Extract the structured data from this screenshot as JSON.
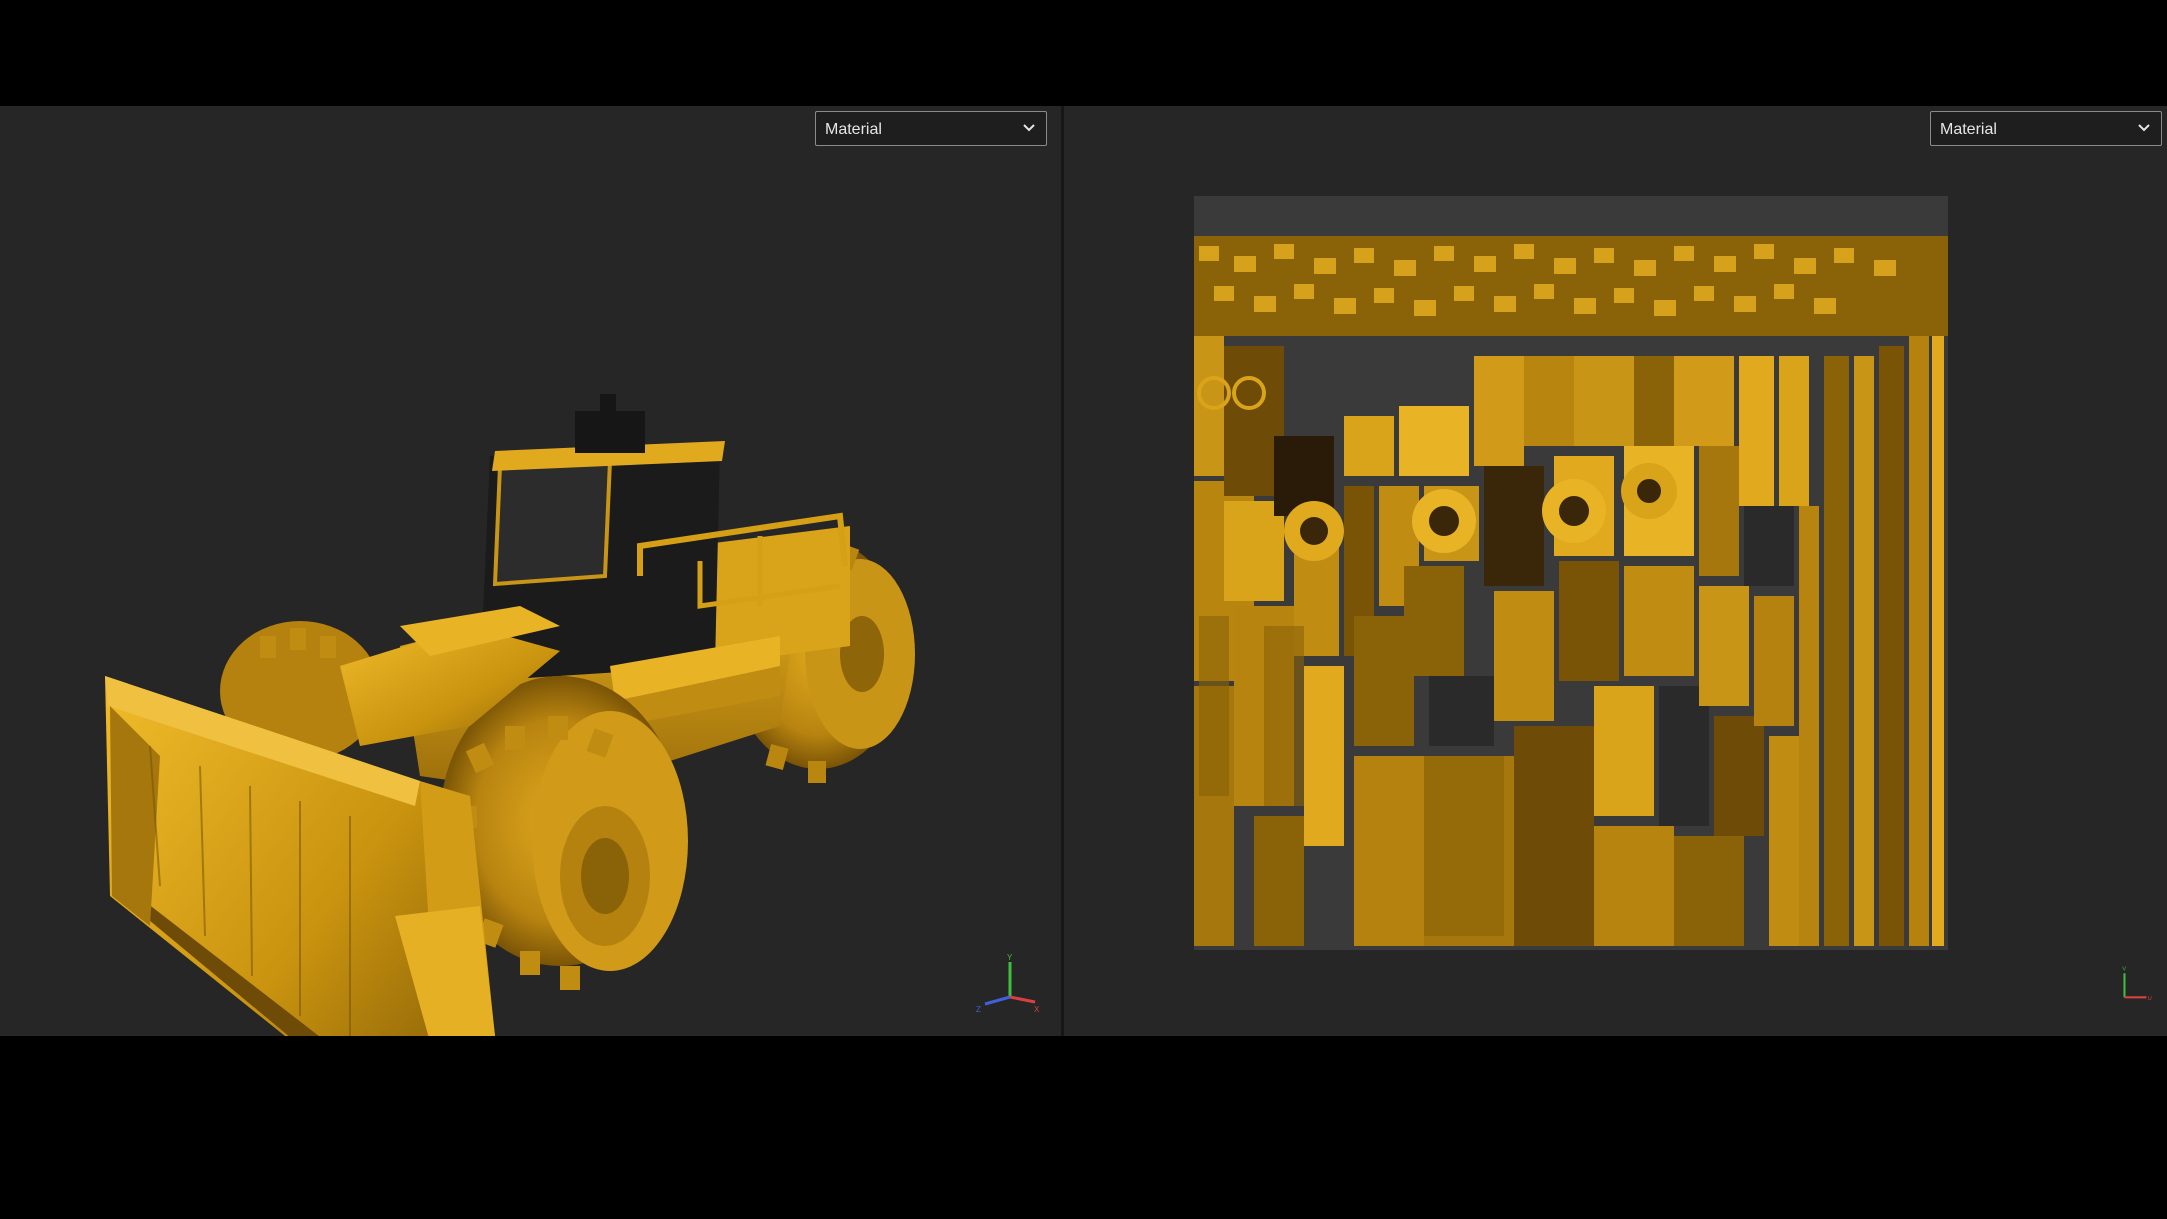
{
  "viewport_3d": {
    "shading_mode": "Material",
    "axis_labels": {
      "y": "Y",
      "x": "X",
      "z": "Z"
    }
  },
  "viewport_uv": {
    "shading_mode": "Material",
    "axis_labels": {
      "v": "V",
      "u": "U"
    }
  },
  "colors": {
    "viewport_bg": "#262626",
    "machine_yellow": "#d4a017",
    "machine_dark": "#1c1c1c",
    "uv_bg": "#3a3a3a"
  },
  "icons": {
    "dropdown": "chevron-down-icon",
    "gizmo": "axis-gizmo-icon"
  }
}
